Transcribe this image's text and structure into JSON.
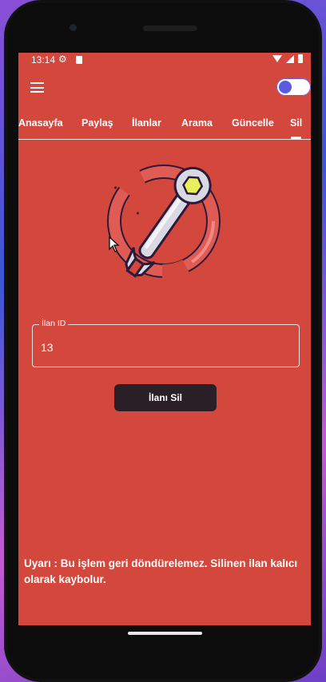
{
  "status_bar": {
    "time": "13:14"
  },
  "toggle": {
    "on": true
  },
  "tabs": [
    {
      "label": "Anasayfa"
    },
    {
      "label": "Paylaş"
    },
    {
      "label": "İlanlar"
    },
    {
      "label": "Arama"
    },
    {
      "label": "Güncelle"
    },
    {
      "label": "Sil"
    }
  ],
  "active_tab": "Sil",
  "form": {
    "id_label": "İlan ID",
    "id_value": "13",
    "delete_button": "İlanı Sil"
  },
  "warning_text": "Uyarı : Bu işlem geri döndürelemez. Silinen ilan kalıcı olarak kaybolur.",
  "colors": {
    "background": "#d4473c",
    "button": "#2b1f27",
    "toggle_knob": "#5b5ae0"
  },
  "icons": {
    "illustration": "wrench-illustration",
    "menu": "hamburger-menu-icon"
  }
}
